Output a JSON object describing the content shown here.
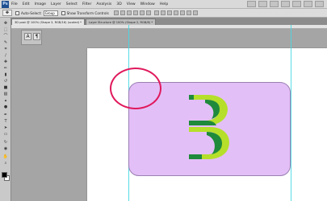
{
  "menubar": {
    "logo": "Ps",
    "items": [
      "File",
      "Edit",
      "Image",
      "Layer",
      "Select",
      "Filter",
      "Analysis",
      "3D",
      "View",
      "Window",
      "Help"
    ]
  },
  "options_bar": {
    "auto_select_label": "Auto-Select:",
    "auto_select_value": "Group",
    "show_transform_label": "Show Transform Controls"
  },
  "tabs": [
    "3D post @ 100% (Shape 3, RGB/16) (scaled) *",
    "Layer Structure @ 100% (Shape 2, RGB/8) *"
  ],
  "colors": {
    "card": "#e3bff7",
    "letter_light": "#b5df2a",
    "letter_dark": "#1f8a3b",
    "highlight_circle": "#e0195c",
    "guides": "#45d8e3"
  },
  "icons": {
    "tools": [
      "move-icon",
      "marquee-icon",
      "lasso-icon",
      "quick-select-icon",
      "crop-icon",
      "eyedropper-icon",
      "healing-icon",
      "brush-icon",
      "stamp-icon",
      "history-brush-icon",
      "eraser-icon",
      "gradient-icon",
      "blur-icon",
      "dodge-icon",
      "pen-icon",
      "type-icon",
      "path-select-icon",
      "shape-icon",
      "3d-rotate-icon",
      "3d-camera-icon",
      "hand-icon",
      "zoom-icon"
    ]
  }
}
